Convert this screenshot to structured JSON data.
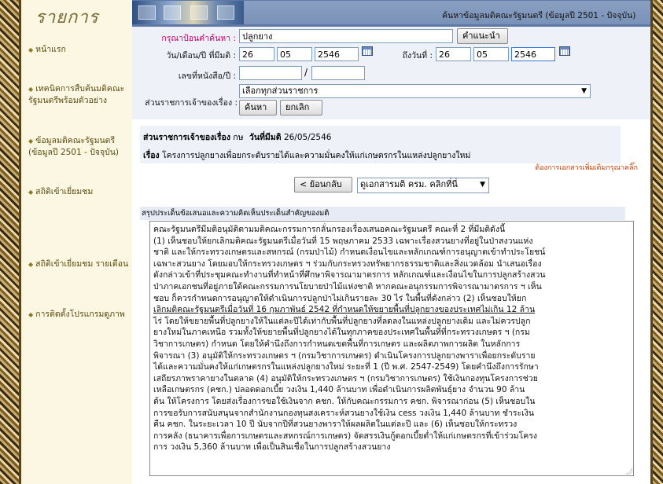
{
  "sidebar": {
    "title": "รายการ",
    "items": [
      {
        "label": "หน้าแรก"
      },
      {
        "label": "เทคนิคการสืบค้นมติคณะรัฐมนตรีพร้อมตัวอย่าง"
      },
      {
        "label": "ข้อมูลมติคณะรัฐมนตรี (ข้อมูลปี 2501 - ปัจจุบัน)"
      },
      {
        "label": "สถิติเข้าเยี่ยมชม"
      },
      {
        "label": "สถิติเข้าเยี่ยมชม รายเดือน"
      },
      {
        "label": "การติดตั้งโปรแกรมดูภาพ"
      }
    ]
  },
  "header": {
    "title": "ค้นหาข้อมูลมติคณะรัฐมนตรี (ข้อมูลปี 2501 - ปัจจุบัน)"
  },
  "search": {
    "keyword_label": "กรุณาป้อนคำค้นหา :",
    "keyword_value": "ปลูกยาง",
    "suggest_button": "คำแนะนำ",
    "date_from_label": "วัน/เดือน/ปี ที่มีมติ :",
    "date_from": {
      "day": "26",
      "month": "05",
      "year": "2546"
    },
    "date_to_label": "ถึงวันที่ :",
    "date_to": {
      "day": "26",
      "month": "05",
      "year": "2546"
    },
    "doc_number_label": "เลขที่หนังสือ/ปี :",
    "doc_number": "",
    "doc_year": "",
    "slash": "/",
    "agency_label": "ส่วนราชการเจ้าของเรื่อง :",
    "agency_selected": "เลือกทุกส่วนราชการ",
    "search_button": "ค้นหา",
    "cancel_button": "ยกเลิก"
  },
  "result": {
    "agency_label": "ส่วนราชการเจ้าของเรื่อง",
    "agency_value": "กษ",
    "date_label": "วันที่มีมติ",
    "date_value": "26/05/2546",
    "subject_label": "เรื่อง",
    "subject_value": "โครงการปลูกยางเพื่อยกระดับรายได้และความมั่นคงให้แก่เกษตรกรในแหล่งปลูกยางใหม่",
    "more_docs_link": "ต้องการเอกสารเพิ่มเติมกรุณาคลิ๊ก",
    "back_button": "< ย้อนกลับ",
    "view_select": "ดูเอกสารมติ ครม. คลิกที่นี่",
    "summary_title": "สรุปประเด็นข้อเสนอและความคิดเห็นประเด็นสำคัญของมติ",
    "summary_lines": [
      "          คณะรัฐมนตรีมีมติอนุมัติตามมติคณะกรรมการกลั่นกรองเรื่องเสนอคณะรัฐมนตรี  คณะที่ 2  ที่มีมติดังนี้",
      "(1) เห็นชอบให้ยกเลิกมติคณะรัฐมนตรีเมื่อวันที่  15  พฤษภาคม  2533 เฉพาะเรื่องสวนยางที่อยู่ในป่าสงวนแห่ง",
      "ชาติ  และให้กระทรวงเกษตรและสหกรณ์ (กรมป่าไม้) กำหนดเงื่อนไขและหลักเกณฑ์การอนุญาตเข้าทำประโยชน์",
      "เฉพาะสวนยาง  โดยมอบให้กระทรวงเกษตร ฯ ร่วมกับกระทรวงทรัพยากรธรรมชาติและสิ่งแวดล้อม นำเสนอเรื่อง",
      "ดังกล่าวเข้าที่ประชุมคณะทำงานที่ทำหน้าที่ศึกษาพิจารณามาตรการ หลักเกณฑ์และเงื่อนไขในการปลูกสร้างสวน",
      "ป่าภาคเอกชนที่อยู่ภายใต้คณะกรรมการนโยบายป่าไม้แห่งชาติ หากคณะอนุกรรมการพิจารณามาตรการ ฯ เห็น",
      "ชอบ ก็ควรกำหนดการอนุญาตให้ดำเนินการปลูกป่าไม่เกินรายละ  30  ไร่  ในพื้นที่ดังกล่าว  (2)  เห็นชอบให้ยก",
      "เลิกมติคณะรัฐมนตรีเมื่อวันที่ 16 กุมภาพันธ์ 2542   ที่กำหนดให้ขยายพื้นที่ปลูกยางของประเทศไม่เกิน 12 ล้าน",
      "ไร่  โดยให้ขยายพื้นที่ปลูกยางให้ในแต่ละปีได้เท่ากับพื้นที่ปลูกยางที่ลดลงในแหล่งปลูกยางเดิม  และไม่ควรปลูก",
      "ยางใหม่ในภาคเหนือ   รวมทั้งให้ขยายพื้นที่ปลูกยางได้ในทุกภาคของประเทศในพื้นที่ที่กระทรวงเกษตร ฯ (กรม",
      "วิชาการเกษตร) กำหนด  โดยให้คำนึงถึงการกำหนดเขตพื้นที่การเกษตร และผลิตภาพการผลิต ในหลักการ",
      "พิจารณา (3) อนุมัติให้กระทรวงเกษตร ฯ (กรมวิชาการเกษตร) ดำเนินโครงการปลูกยางพาราเพื่อยกระดับราย",
      "ได้และความมั่นคงให้แก่เกษตรกรในแหล่งปลูกยางใหม่  ระยะที่ 1 (ปี พ.ศ. 2547-2549) โดยคำนึงถึงการรักษา",
      "เสถียรภาพราคายางในตลาด  (4) อนุมัติให้กระทรวงเกษตร ฯ (กรมวิชาการเกษตร) ใช้เงินกองทุนโครงการช่วย",
      "เหลือเกษตรกร (คชก.) ปลอดดอกเบี้ย วงเงิน 1,440 ล้านบาท  เพื่อดำเนินการผลิตพันธุ์ยาง จำนวน  90  ล้าน",
      "ต้น ให้โครงการ  โดยส่งเรื่องการขอใช้เงินจาก คชก. ให้กับคณะกรรมการ คชก.  พิจารณาก่อน  (5)  เห็นชอบใน",
      "การขอรับการสนับสนุนจากสำนักงานกองทุนสงเคราะห์สวนยางใช้เงิน cess วงเงิน  1,440  ล้านบาท ชำระเงิน",
      "คืน คชก.  ในระยะเวลา  10  ปี นับจากปีที่สวนยางพาราให้ผลผลิตในแต่ละปี   และ  (6)  เห็นชอบให้กระทรวง",
      "การคลัง (ธนาคารเพื่อการเกษตรและสหกรณ์การเกษตร) จัดสรรเงินกู้ดอกเบี้ยต่ำให้แก่เกษตรกรที่เข้าร่วมโครง",
      "การ วงเงิน 5,360 ล้านบาท เพื่อเป็นสินเชื่อในการปลูกสร้างสวนยาง"
    ]
  }
}
